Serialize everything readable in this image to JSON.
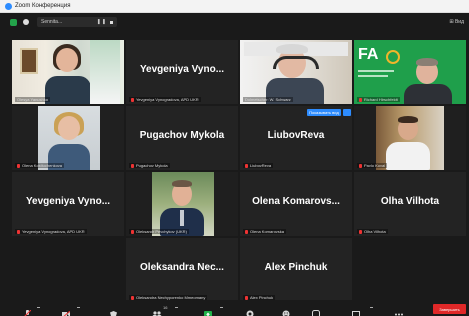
{
  "window": {
    "title": "Zoom Конференция"
  },
  "topbar": {
    "speaker_label": "Sennita...",
    "view_label": "Вид"
  },
  "tiles": [
    {
      "bigname": "",
      "nametag": "Olesya Yanushko",
      "mic": "on"
    },
    {
      "bigname": "Yevgeniya Vyno...",
      "nametag": "Yevgeniya Vynogradova, APD UKR",
      "mic": "off"
    },
    {
      "bigname": "",
      "nametag": "Dolmetscher: W. Schwarz",
      "mic": "on"
    },
    {
      "bigname": "",
      "nametag": "Richard Hirschfeldt",
      "mic": "off"
    },
    {
      "bigname": "",
      "nametag": "Olena Kostiuchenkova",
      "mic": "off"
    },
    {
      "bigname": "Pugachov Mykola",
      "nametag": "Pugachov Mykola",
      "mic": "off"
    },
    {
      "bigname": "LiubovReva",
      "nametag": "LiubovReva",
      "mic": "off"
    },
    {
      "bigname": "",
      "nametag": "Pavlo Koval",
      "mic": "off"
    },
    {
      "bigname": "Yevgeniya Vyno...",
      "nametag": "Yevgeniya Vynogradova, APD UKR",
      "mic": "off"
    },
    {
      "bigname": "",
      "nametag": "Oleksandr Pevchykov (UKR)",
      "mic": "off"
    },
    {
      "bigname": "Olena Komarovs...",
      "nametag": "Olena Komarovska",
      "mic": "off"
    },
    {
      "bigname": "Olha Vilhota",
      "nametag": "Olha Vilhota",
      "mic": "off"
    },
    {
      "bigname": "Oleksandra Nec...",
      "nametag": "Oleksandra Nechyporenko Mmeomany",
      "mic": "off"
    },
    {
      "bigname": "Alex Pinchuk",
      "nametag": "Alex Pinchuk",
      "mic": "off"
    }
  ],
  "overlay": {
    "translate_label": "Показывать вид"
  },
  "fa_logo": {
    "text": "FA"
  },
  "toolbar": {
    "participants_count": "16",
    "leave_label": "Завершить"
  },
  "colors": {
    "active_border": "#f0e54b",
    "accent": "#2d8cff",
    "danger": "#e02828",
    "fa_green": "#1f9f4b"
  }
}
